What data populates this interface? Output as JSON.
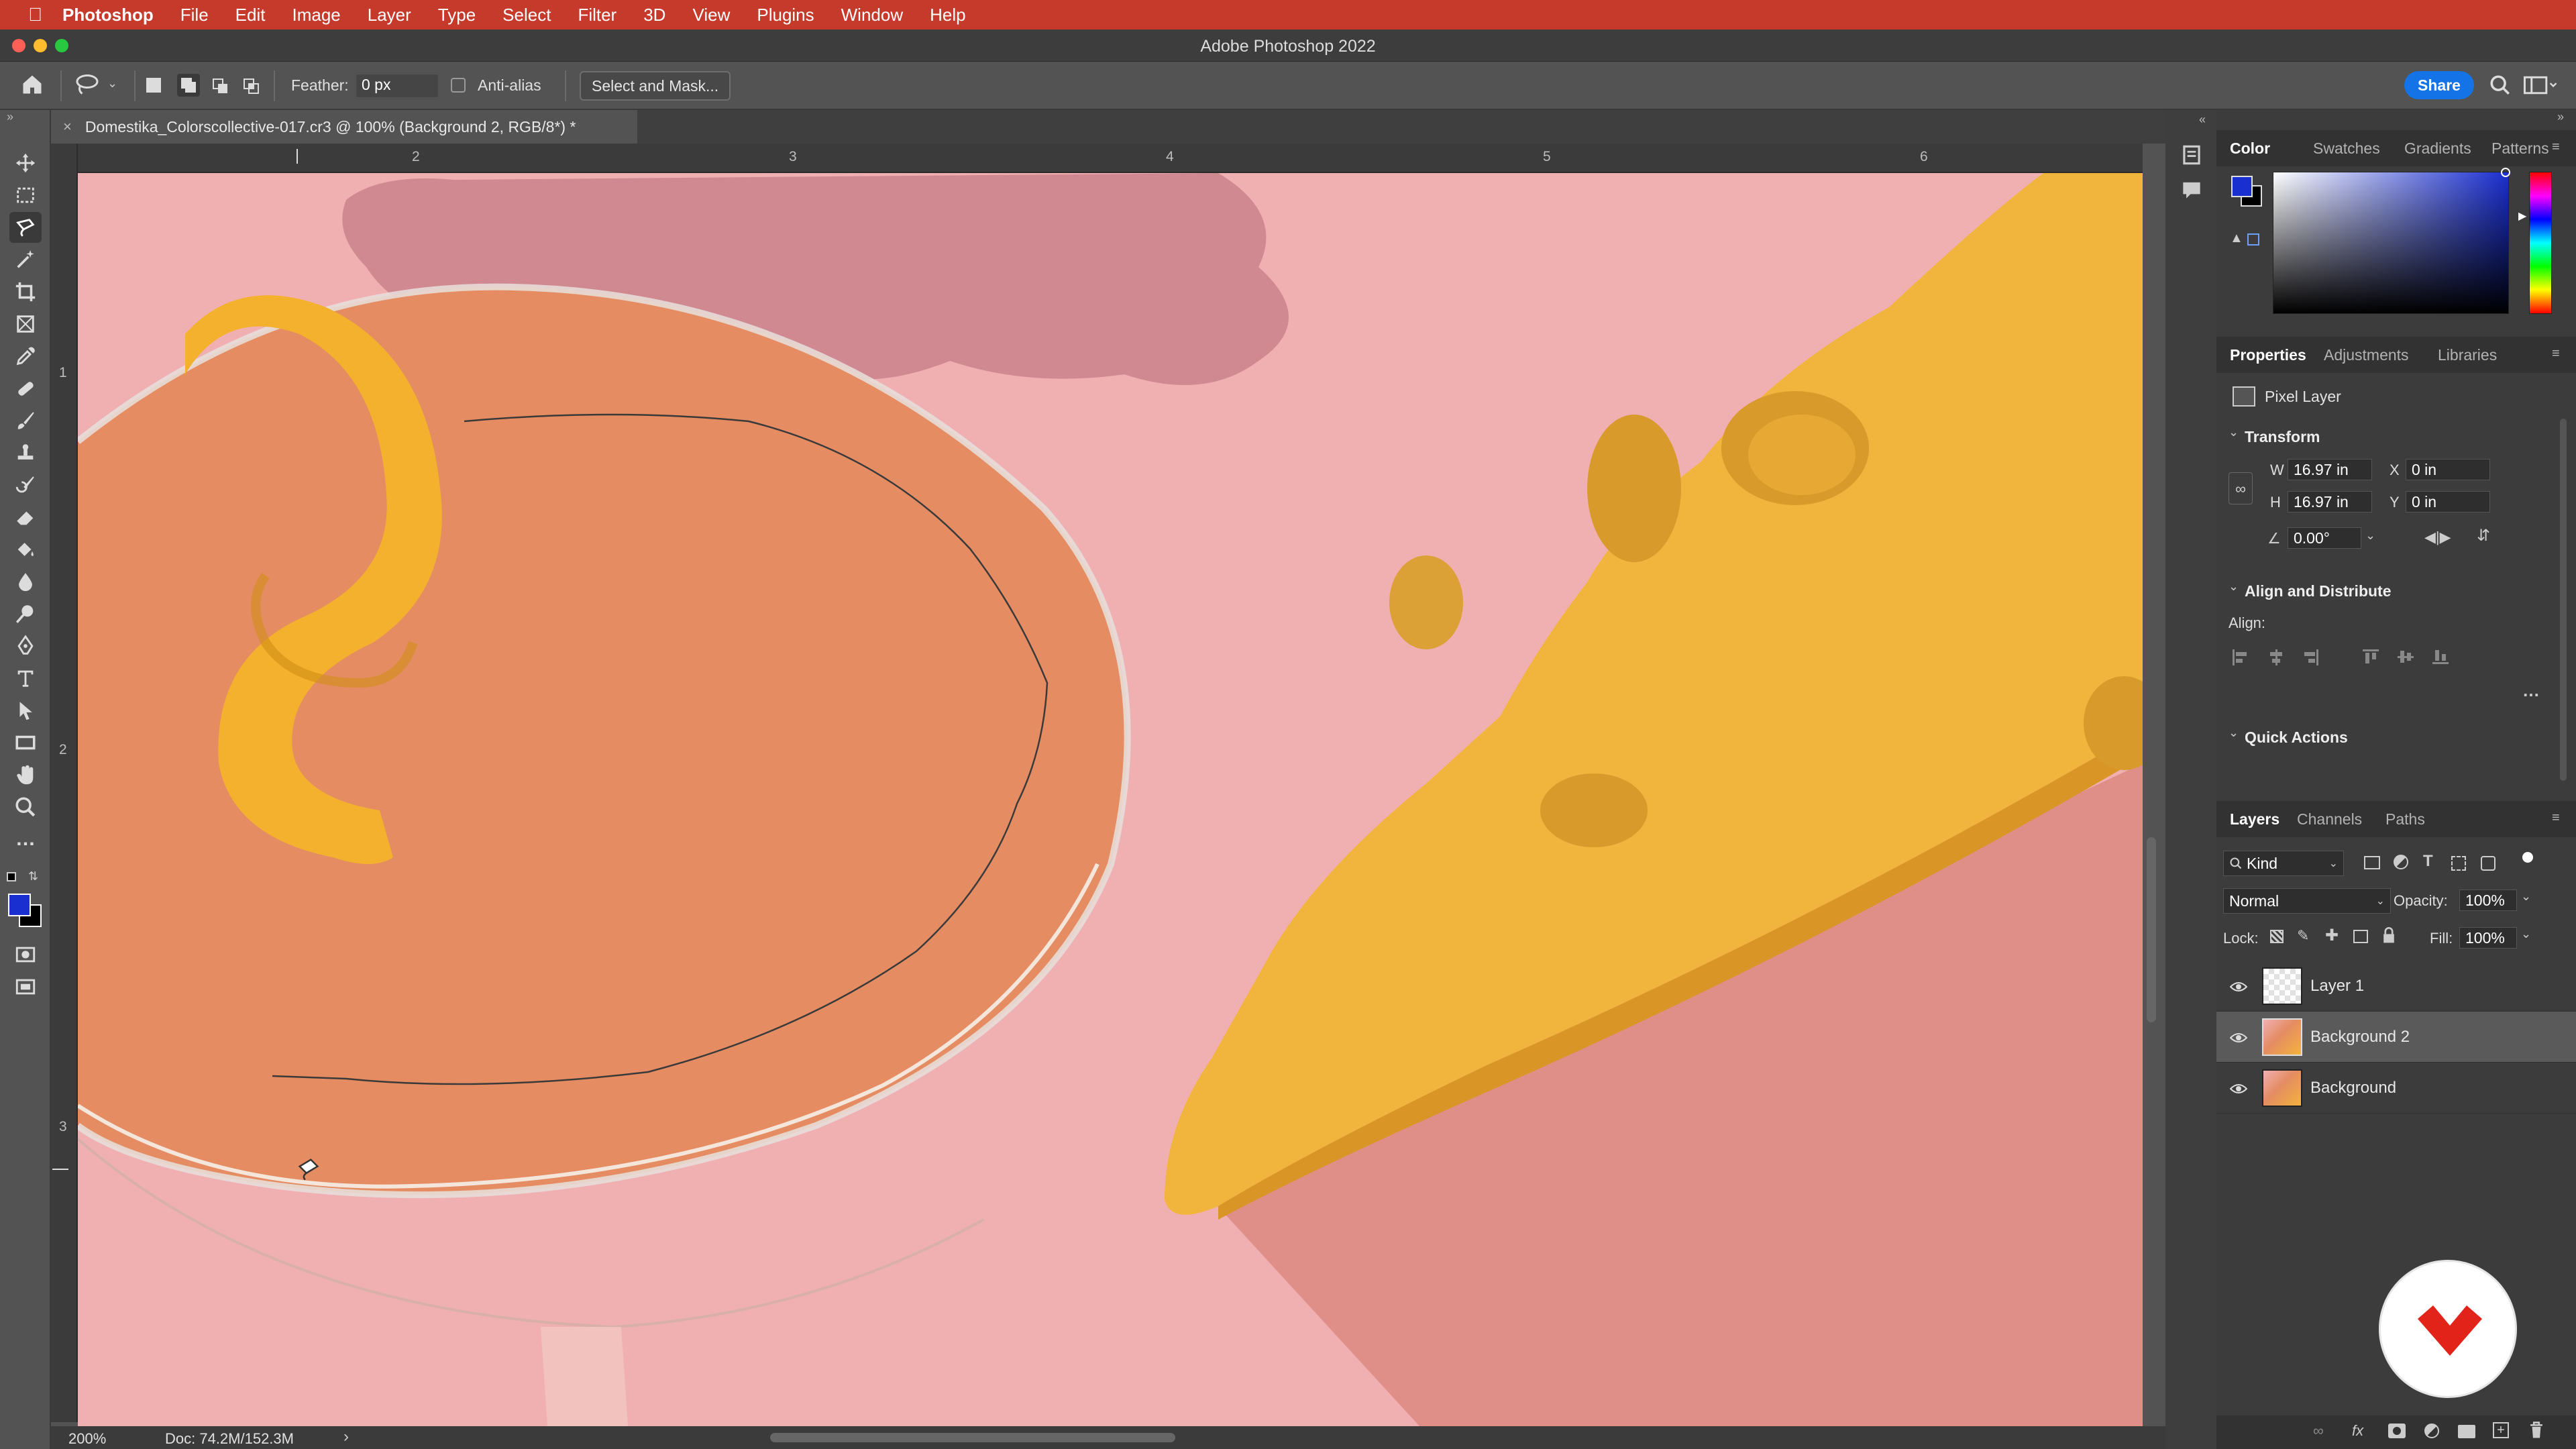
{
  "menubar": {
    "app": "Photoshop",
    "items": [
      "File",
      "Edit",
      "Image",
      "Layer",
      "Type",
      "Select",
      "Filter",
      "3D",
      "View",
      "Plugins",
      "Window",
      "Help"
    ]
  },
  "window": {
    "title": "Adobe Photoshop 2022"
  },
  "options": {
    "feather_label": "Feather:",
    "feather_value": "0 px",
    "antialias_label": "Anti-alias",
    "select_mask": "Select and Mask...",
    "share": "Share"
  },
  "document": {
    "tab_title": "Domestika_Colorscollective-017.cr3 @ 100% (Background 2, RGB/8*) *"
  },
  "ruler": {
    "h_ticks": [
      "2",
      "3",
      "4",
      "5",
      "6"
    ],
    "v_ticks": [
      "1",
      "2",
      "3"
    ]
  },
  "color_panel": {
    "tabs": [
      "Color",
      "Swatches",
      "Gradients",
      "Patterns"
    ],
    "fg_color": "#1a2fd0",
    "bg_color": "#000000"
  },
  "properties": {
    "tabs": [
      "Properties",
      "Adjustments",
      "Libraries"
    ],
    "kind": "Pixel Layer",
    "transform_title": "Transform",
    "w_label": "W",
    "w_value": "16.97 in",
    "h_label": "H",
    "h_value": "16.97 in",
    "x_label": "X",
    "x_value": "0 in",
    "y_label": "Y",
    "y_value": "0 in",
    "angle": "0.00°",
    "align_title": "Align and Distribute",
    "align_label": "Align:",
    "quick_actions": "Quick Actions"
  },
  "layers_panel": {
    "tabs": [
      "Layers",
      "Channels",
      "Paths"
    ],
    "kind": "Kind",
    "blend": "Normal",
    "opacity_label": "Opacity:",
    "opacity": "100%",
    "lock_label": "Lock:",
    "fill_label": "Fill:",
    "fill": "100%",
    "layers": [
      {
        "name": "Layer 1",
        "selected": false
      },
      {
        "name": "Background 2",
        "selected": true
      },
      {
        "name": "Background",
        "selected": false
      }
    ]
  },
  "status": {
    "zoom": "200%",
    "doc": "Doc: 74.2M/152.3M"
  },
  "colors": {
    "menubar": "#c53a2b",
    "share": "#1473e6",
    "canvas_bg": "#f0b0b2",
    "cheese": "#f1b43c"
  }
}
